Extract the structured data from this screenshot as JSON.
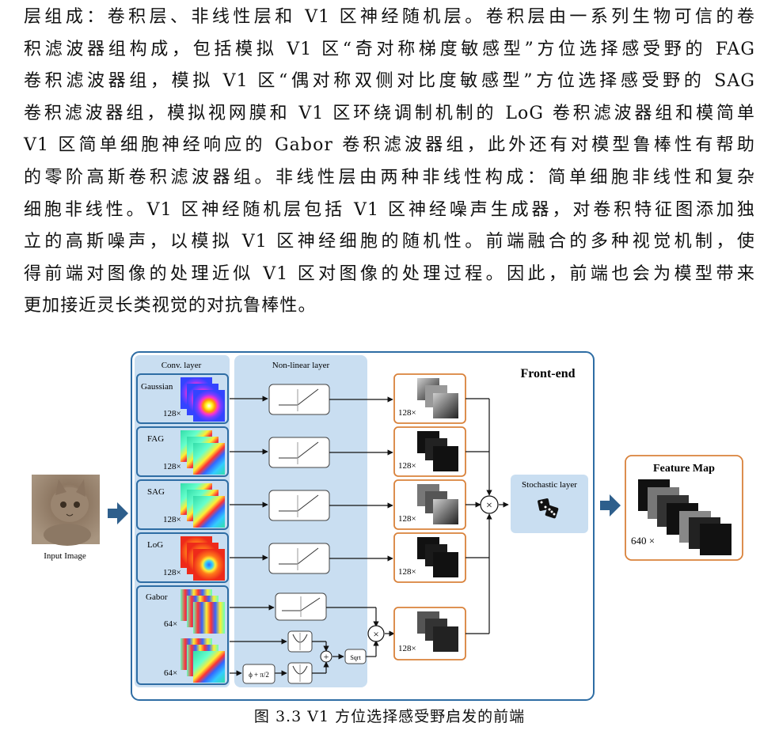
{
  "paragraph": {
    "lines": [
      "层组成：卷积层、非线性层和 V1 区神经随机层。卷积层由一系列生物可信的卷",
      "积滤波器组构成，包括模拟 V1 区“奇对称梯度敏感型”方位选择感受野的 FAG",
      "卷积滤波器组，模拟 V1 区“偶对称双侧对比度敏感型”方位选择感受野的 SAG",
      "卷积滤波器组，模拟视网膜和 V1 区环绕调制机制的 LoG 卷积滤波器组和模简单",
      "V1 区简单细胞神经响应的 Gabor 卷积滤波器组，此外还有对模型鲁棒性有帮助",
      "的零阶高斯卷积滤波器组。非线性层由两种非线性构成：简单细胞非线性和复杂",
      "细胞非线性。V1 区神经随机层包括 V1 区神经噪声生成器，对卷积特征图添加独",
      "立的高斯噪声，以模拟 V1 区神经细胞的随机性。前端融合的多种视觉机制，使",
      "得前端对图像的处理近似 V1 区对图像的处理过程。因此，前端也会为模型带来",
      "更加接近灵长类视觉的对抗鲁棒性。"
    ]
  },
  "figure": {
    "input_label": "Input Image",
    "frontend_title": "Front-end",
    "conv_title": "Conv. layer",
    "nonlinear_title": "Non-linear layer",
    "filters": [
      {
        "name": "Gaussian",
        "count": "128×"
      },
      {
        "name": "FAG",
        "count": "128×"
      },
      {
        "name": "SAG",
        "count": "128×"
      },
      {
        "name": "LoG",
        "count": "128×"
      },
      {
        "name": "Gabor",
        "count": "64×",
        "count2": "64×"
      }
    ],
    "map_counts": [
      "128×",
      "128×",
      "128×",
      "128×",
      "128×"
    ],
    "phase_shift": "ϕ + π/2",
    "sqrt_label": "Sqrt",
    "stochastic_title": "Stochastic layer",
    "feature_title": "Feature Map",
    "feature_count": "640 ×",
    "colors": {
      "frame": "#2e6da4",
      "panel": "#c9def1",
      "arrow_fill": "#2e5f8c",
      "orange": "#d9823b"
    }
  },
  "caption": "图 3.3 V1 方位选择感受野启发的前端"
}
